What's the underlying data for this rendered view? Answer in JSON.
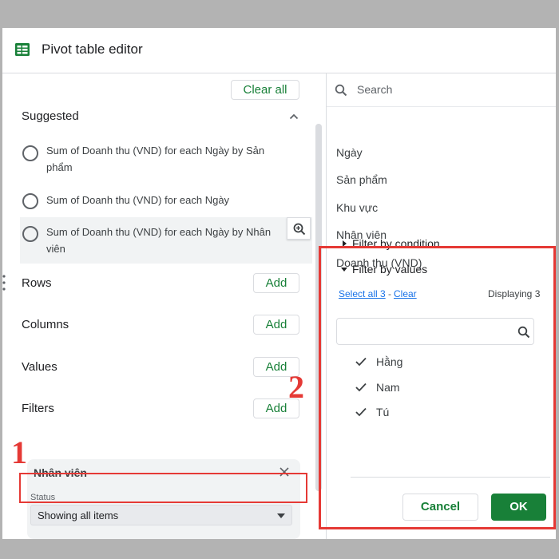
{
  "header": {
    "title": "Pivot table editor",
    "icon": "sheets-icon"
  },
  "left": {
    "clear_all": "Clear all",
    "suggested": {
      "title": "Suggested",
      "items": [
        {
          "label": "Sum of Doanh thu (VND) for each Ngày by Sản phẩm"
        },
        {
          "label": "Sum of Doanh thu (VND) for each Ngày"
        },
        {
          "label": "Sum of Doanh thu (VND) for each Ngày by Nhân viên"
        }
      ]
    },
    "sections": [
      {
        "label": "Rows",
        "button": "Add"
      },
      {
        "label": "Columns",
        "button": "Add"
      },
      {
        "label": "Values",
        "button": "Add"
      },
      {
        "label": "Filters",
        "button": "Add"
      }
    ],
    "filter_card": {
      "title": "Nhân viên",
      "status_label": "Status",
      "status_value": "Showing all items"
    }
  },
  "right": {
    "search_placeholder": "Search",
    "fields": [
      "Ngày",
      "Sản phẩm",
      "Khu vực",
      "Nhân viên",
      "Doanh thu (VND)"
    ],
    "filter_by_condition": "Filter by condition",
    "filter_by_values": "Filter by values",
    "select_all": "Select all 3",
    "separator": "-",
    "clear": "Clear",
    "displaying": "Displaying 3",
    "values": [
      {
        "label": "Hằng",
        "checked": true
      },
      {
        "label": "Nam",
        "checked": true
      },
      {
        "label": "Tú",
        "checked": true
      }
    ],
    "cancel": "Cancel",
    "ok": "OK"
  },
  "annotations": {
    "mark_1": "1",
    "mark_2": "2"
  },
  "colors": {
    "accent_green": "#188038",
    "annotation_red": "#e53935",
    "link_blue": "#1a73e8"
  }
}
